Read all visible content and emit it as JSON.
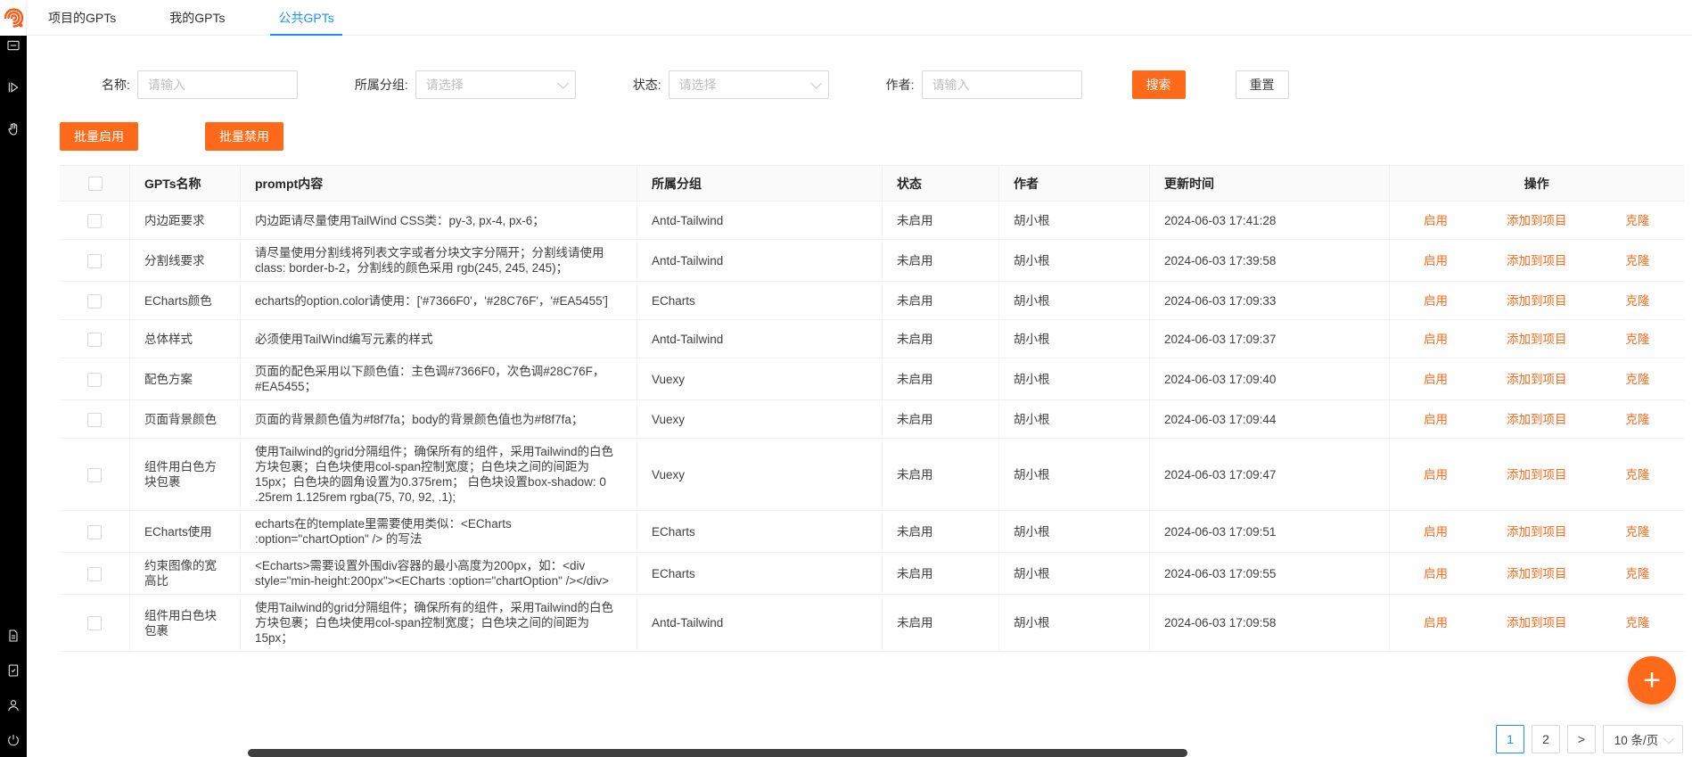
{
  "colors": {
    "accent": "#ff6a1a",
    "tab_active": "#1890ff"
  },
  "navbar": {
    "tabs": [
      {
        "label": "项目的GPTs",
        "active": false
      },
      {
        "label": "我的GPTs",
        "active": false
      },
      {
        "label": "公共GPTs",
        "active": true
      }
    ]
  },
  "sidebar": {
    "icons_top": [
      "collapse-panel-icon",
      "run-icon",
      "hand-icon"
    ],
    "icons_bottom": [
      "document-icon",
      "audit-icon",
      "user-icon",
      "power-icon"
    ]
  },
  "filters": {
    "name_label": "名称:",
    "name_placeholder": "请输入",
    "group_label": "所属分组:",
    "group_placeholder": "请选择",
    "status_label": "状态:",
    "status_placeholder": "请选择",
    "author_label": "作者:",
    "author_placeholder": "请输入",
    "search_label": "搜索",
    "reset_label": "重置"
  },
  "batch": {
    "enable_label": "批量启用",
    "disable_label": "批量禁用"
  },
  "table": {
    "columns": [
      "",
      "GPTs名称",
      "prompt内容",
      "所属分组",
      "状态",
      "作者",
      "更新时间",
      "操作"
    ],
    "row_action_labels": [
      "启用",
      "添加到项目",
      "克隆"
    ],
    "rows": [
      {
        "name": "内边距要求",
        "prompt": "内边距请尽量使用TailWind CSS类：py-3, px-4, px-6；",
        "group": "Antd-Tailwind",
        "status": "未启用",
        "author": "胡小根",
        "updated": "2024-06-03 17:41:28"
      },
      {
        "name": "分割线要求",
        "prompt": "请尽量使用分割线将列表文字或者分块文字分隔开；分割线请使用class: border-b-2，分割线的颜色采用 rgb(245, 245, 245)；",
        "group": "Antd-Tailwind",
        "status": "未启用",
        "author": "胡小根",
        "updated": "2024-06-03 17:39:58"
      },
      {
        "name": "ECharts颜色",
        "prompt": "echarts的option.color请使用：['#7366F0'，'#28C76F'，'#EA5455']",
        "group": "ECharts",
        "status": "未启用",
        "author": "胡小根",
        "updated": "2024-06-03 17:09:33"
      },
      {
        "name": "总体样式",
        "prompt": "必须使用TailWind编写元素的样式",
        "group": "Antd-Tailwind",
        "status": "未启用",
        "author": "胡小根",
        "updated": "2024-06-03 17:09:37"
      },
      {
        "name": "配色方案",
        "prompt": "页面的配色采用以下颜色值：主色调#7366F0，次色调#28C76F，#EA5455；",
        "group": "Vuexy",
        "status": "未启用",
        "author": "胡小根",
        "updated": "2024-06-03 17:09:40"
      },
      {
        "name": "页面背景颜色",
        "prompt": "页面的背景颜色值为#f8f7fa；body的背景颜色值也为#f8f7fa；",
        "group": "Vuexy",
        "status": "未启用",
        "author": "胡小根",
        "updated": "2024-06-03 17:09:44"
      },
      {
        "name": "组件用白色方块包裹",
        "prompt": "使用Tailwind的grid分隔组件；确保所有的组件，采用Tailwind的白色方块包裹；白色块使用col-span控制宽度；白色块之间的间距为15px；白色块的圆角设置为0.375rem； 白色块设置box-shadow: 0 .25rem 1.125rem rgba(75, 70, 92, .1);",
        "group": "Vuexy",
        "status": "未启用",
        "author": "胡小根",
        "updated": "2024-06-03 17:09:47"
      },
      {
        "name": "ECharts使用",
        "prompt": "echarts在的template里需要使用类似：<ECharts :option=\"chartOption\" /> 的写法",
        "group": "ECharts",
        "status": "未启用",
        "author": "胡小根",
        "updated": "2024-06-03 17:09:51"
      },
      {
        "name": "约束图像的宽高比",
        "prompt": "<Echarts>需要设置外围div容器的最小高度为200px，如：<div style=\"min-height:200px\"><ECharts :option=\"chartOption\" /></div>",
        "group": "ECharts",
        "status": "未启用",
        "author": "胡小根",
        "updated": "2024-06-03 17:09:55"
      },
      {
        "name": "组件用白色块包裹",
        "prompt": "使用Tailwind的grid分隔组件；确保所有的组件，采用Tailwind的白色方块包裹；白色块使用col-span控制宽度；白色块之间的间距为15px；",
        "group": "Antd-Tailwind",
        "status": "未启用",
        "author": "胡小根",
        "updated": "2024-06-03 17:09:58"
      }
    ]
  },
  "pagination": {
    "pages": [
      "1",
      "2"
    ],
    "active_page": "1",
    "next_label": ">",
    "page_size_label": "10 条/页"
  },
  "fab": {
    "label": "+"
  }
}
